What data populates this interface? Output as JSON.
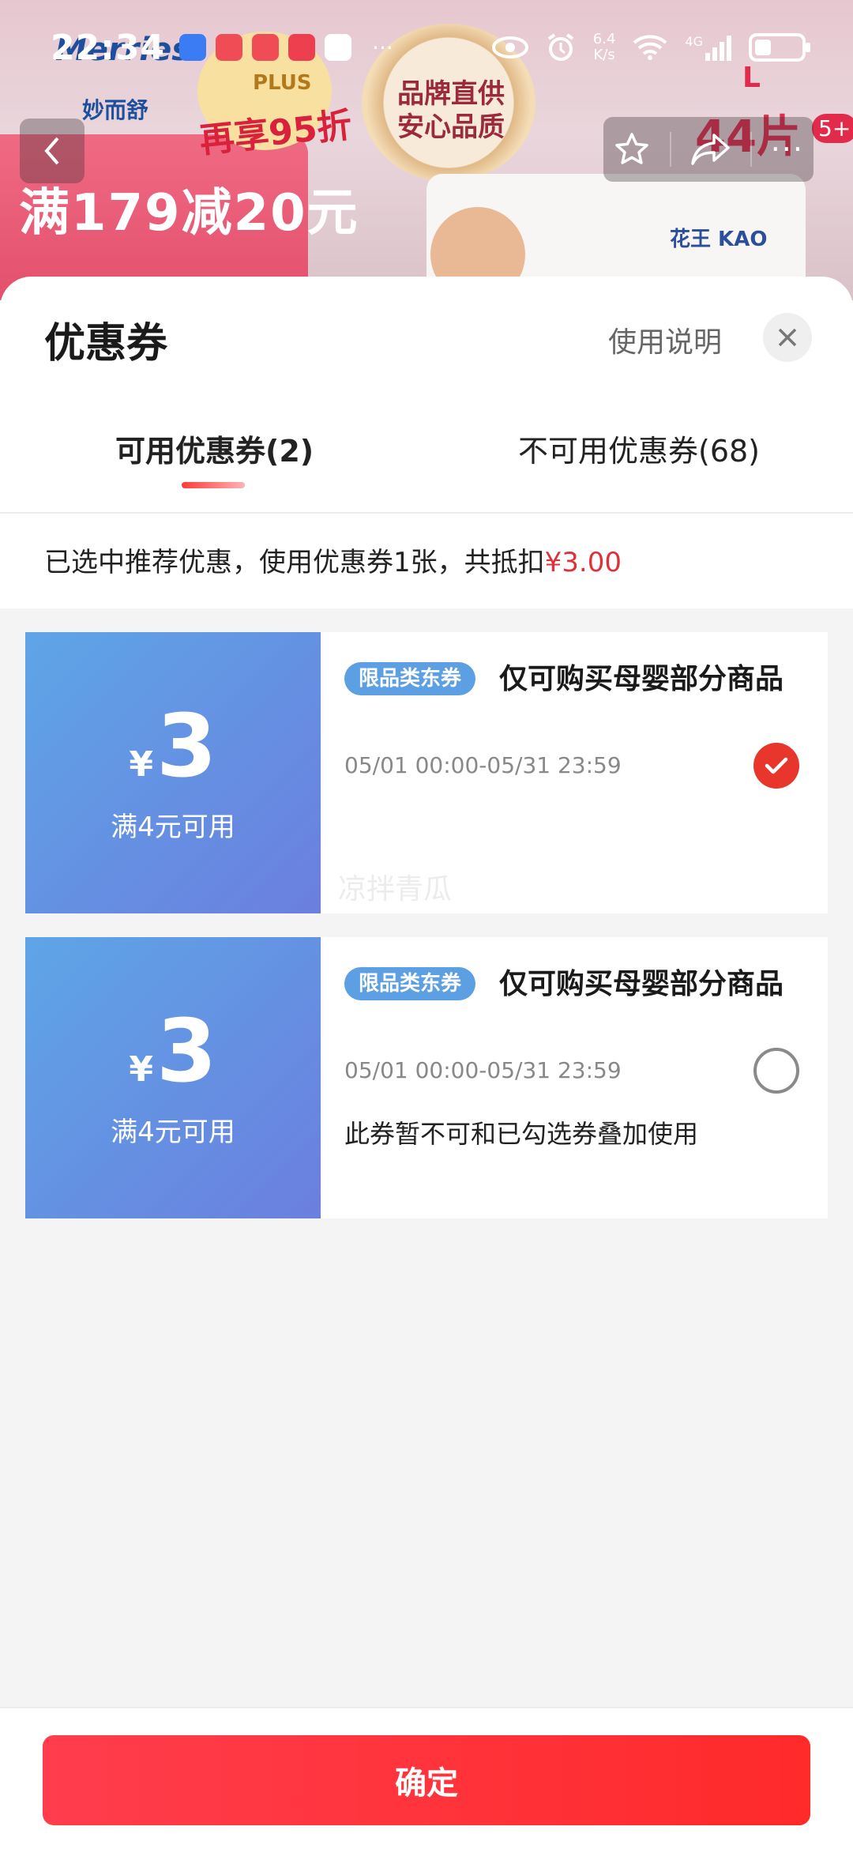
{
  "status_bar": {
    "time": "22:34",
    "net_speed_value": "6.4",
    "net_speed_unit": "K/s",
    "network": "4G",
    "battery_level": 0.35
  },
  "product_banner": {
    "brand": "Merries",
    "brand_cn": "妙而舒",
    "plus_label": "PLUS",
    "plus_discount": "再享95折",
    "medal_text": "品牌直供安心品质",
    "promo": "满179减20元",
    "size": "L",
    "count": "44片",
    "age": "5+",
    "maker": "花王 KAO"
  },
  "sheet": {
    "title": "优惠券",
    "help_label": "使用说明",
    "tabs": [
      {
        "label": "可用优惠券(2)",
        "active": true
      },
      {
        "label": "不可用优惠券(68)",
        "active": false
      }
    ],
    "summary_text": "已选中推荐优惠，使用优惠券1张，共抵扣",
    "summary_amount": "¥3.00"
  },
  "coupons": [
    {
      "currency": "¥",
      "amount": "3",
      "condition": "满4元可用",
      "tag": "限品类东券",
      "title": "仅可购买母婴部分商品",
      "validity": "05/01 00:00-05/31 23:59",
      "note": "",
      "watermark": "凉拌青瓜",
      "selected": true
    },
    {
      "currency": "¥",
      "amount": "3",
      "condition": "满4元可用",
      "tag": "限品类东券",
      "title": "仅可购买母婴部分商品",
      "validity": "05/01 00:00-05/31 23:59",
      "note": "此券暂不可和已勾选券叠加使用",
      "watermark": "",
      "selected": false
    }
  ],
  "footer": {
    "confirm_label": "确定"
  },
  "colors": {
    "accent_red": "#e8362c",
    "coupon_blue_start": "#5ea5e6",
    "coupon_blue_end": "#6b7fdf",
    "tag_blue": "#5c9fe3"
  }
}
